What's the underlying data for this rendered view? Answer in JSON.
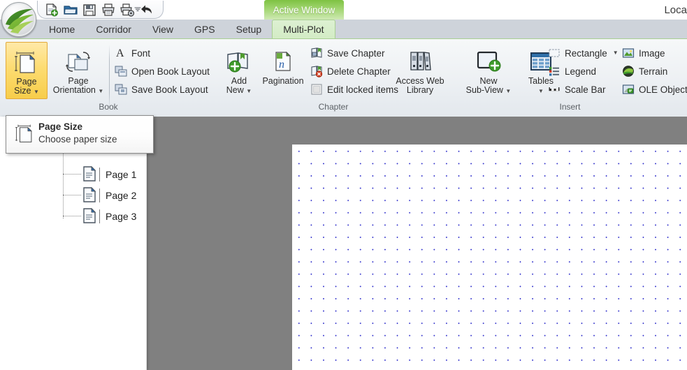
{
  "window": {
    "title_fragment": "Loca"
  },
  "quick_access": {
    "items": [
      {
        "name": "new-document-icon",
        "label": "New"
      },
      {
        "name": "open-folder-icon",
        "label": "Open"
      },
      {
        "name": "save-icon",
        "label": "Save"
      },
      {
        "name": "print-icon",
        "label": "Print"
      },
      {
        "name": "print-setup-icon",
        "label": "Print Setup"
      },
      {
        "name": "undo-icon",
        "label": "Undo"
      }
    ],
    "customize_label": "☰"
  },
  "contextual_tab": {
    "label": "Active Window"
  },
  "tabs": [
    {
      "label": "Home",
      "active": false
    },
    {
      "label": "Corridor",
      "active": false
    },
    {
      "label": "View",
      "active": false
    },
    {
      "label": "GPS",
      "active": false
    },
    {
      "label": "Setup",
      "active": false
    },
    {
      "label": "Multi-Plot",
      "active": true
    }
  ],
  "ribbon": {
    "groups": [
      {
        "name": "Book",
        "label": "Book",
        "big_buttons": [
          {
            "label_line1": "Page",
            "label_line2": "Size",
            "icon": "page-size-icon",
            "selected": true,
            "has_caret": true
          },
          {
            "label_line1": "Page",
            "label_line2": "Orientation",
            "icon": "page-orientation-icon",
            "selected": false,
            "has_caret": true
          }
        ],
        "small_buttons": [
          {
            "label": "Font",
            "icon": "font-icon"
          },
          {
            "label": "Open Book Layout",
            "icon": "open-book-layout-icon"
          },
          {
            "label": "Save Book Layout",
            "icon": "save-book-layout-icon"
          }
        ]
      },
      {
        "name": "Chapter",
        "label": "Chapter",
        "big_buttons": [
          {
            "label_line1": "Add",
            "label_line2": "New",
            "icon": "add-new-chapter-icon",
            "selected": false,
            "has_caret": true
          },
          {
            "label_line1": "Pagination",
            "label_line2": "",
            "icon": "pagination-icon",
            "selected": false,
            "has_caret": false
          },
          {
            "label_line1": "Access Web",
            "label_line2": "Library",
            "icon": "access-web-library-icon",
            "selected": false,
            "has_caret": false
          }
        ],
        "small_buttons": [
          {
            "label": "Save Chapter",
            "icon": "save-chapter-icon"
          },
          {
            "label": "Delete Chapter",
            "icon": "delete-chapter-icon"
          },
          {
            "label": "Edit locked items",
            "icon": "edit-locked-items-checkbox"
          }
        ]
      },
      {
        "name": "Insert",
        "label": "Insert",
        "big_buttons": [
          {
            "label_line1": "New",
            "label_line2": "Sub-View",
            "icon": "new-subview-icon",
            "selected": false,
            "has_caret": true
          },
          {
            "label_line1": "Tables",
            "label_line2": "",
            "icon": "tables-icon",
            "selected": false,
            "has_caret": true
          }
        ],
        "small_buttons": [
          {
            "label": "Rectangle",
            "icon": "rectangle-icon",
            "has_caret": true
          },
          {
            "label": "Legend",
            "icon": "legend-icon",
            "has_caret": false
          },
          {
            "label": "Scale Bar",
            "icon": "scale-bar-icon",
            "has_caret": false
          },
          {
            "label": "Image",
            "icon": "image-icon",
            "has_caret": false
          },
          {
            "label": "Terrain",
            "icon": "terrain-icon",
            "has_caret": false
          },
          {
            "label": "OLE Object",
            "icon": "ole-object-icon",
            "has_caret": false
          }
        ]
      }
    ]
  },
  "tooltip": {
    "title": "Page Size",
    "description": "Choose paper size",
    "icon": "page-size-icon"
  },
  "tree": {
    "items": [
      {
        "label": "Page 1",
        "icon": "page-document-icon"
      },
      {
        "label": "Page 2",
        "icon": "page-document-icon"
      },
      {
        "label": "Page 3",
        "icon": "page-document-icon"
      }
    ]
  },
  "colors": {
    "accent_green": "#7ec242",
    "selection_yellow": "#f7cd4a",
    "highlight_yellow": "#f5eb6a",
    "canvas_background": "#ffffff",
    "grid_dot": "#3333cc",
    "workspace_gray": "#808080",
    "tabstrip": "#ced3da"
  }
}
